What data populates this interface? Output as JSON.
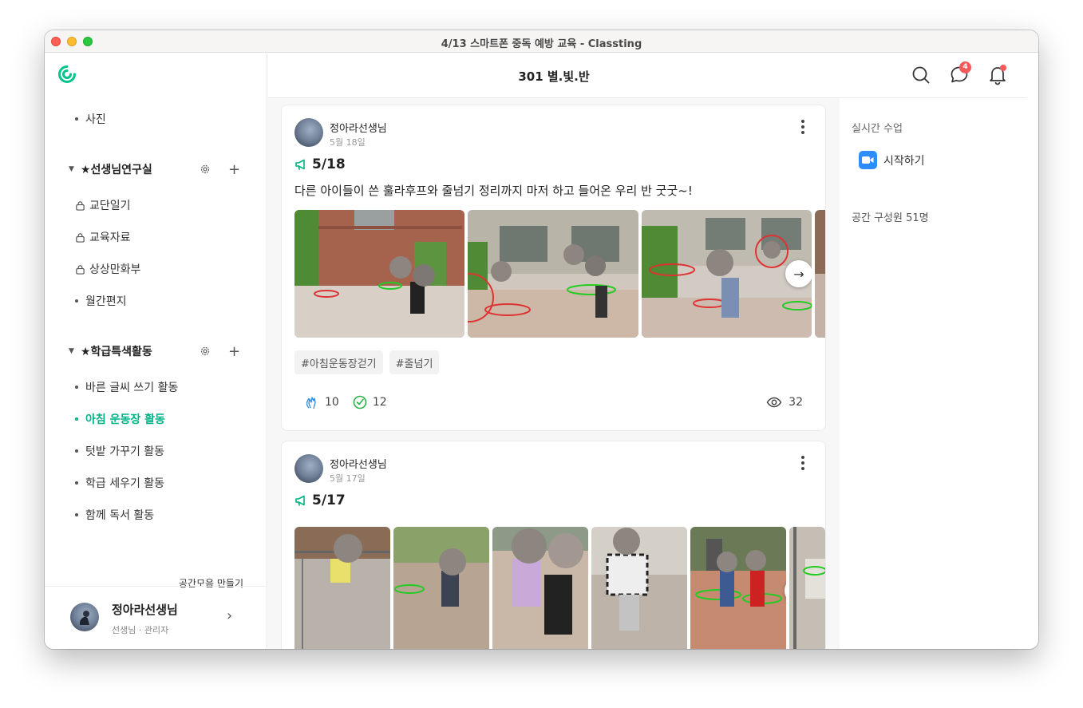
{
  "window": {
    "title": "4/13 스마트폰 중독 예방 교육 - Classting"
  },
  "sidebar": {
    "top_item": "사진",
    "sections": [
      {
        "title": "★선생님연구실",
        "items": [
          {
            "label": "교단일기",
            "locked": true
          },
          {
            "label": "교육자료",
            "locked": true
          },
          {
            "label": "상상만화부",
            "locked": true
          },
          {
            "label": "월간편지",
            "locked": false
          }
        ]
      },
      {
        "title": "★학급특색활동",
        "items": [
          {
            "label": "바른 글씨 쓰기 활동"
          },
          {
            "label": "아침 운동장 활동",
            "active": true
          },
          {
            "label": "텃밭 가꾸기 활동"
          },
          {
            "label": "학급 세우기 활동"
          },
          {
            "label": "함께 독서 활동"
          }
        ]
      }
    ],
    "make_collection": "공간모음 만들기",
    "profile": {
      "name": "정아라선생님",
      "role": "선생님 · 관리자"
    }
  },
  "header": {
    "class_name": "301 별.빛.반",
    "chat_badge": "4"
  },
  "posts": [
    {
      "author": "정아라선생님",
      "date": "5월 18일",
      "title": "5/18",
      "body": "다른 아이들이 쓴 훌라후프와 줄넘기 정리까지 마저 하고 들어온 우리 반 굿굿~!",
      "tags": [
        "#아침운동장걷기",
        "#줄넘기"
      ],
      "clap_count": "10",
      "check_count": "12",
      "view_count": "32"
    },
    {
      "author": "정아라선생님",
      "date": "5월 17일",
      "title": "5/17"
    }
  ],
  "right_panel": {
    "live_class_label": "실시간 수업",
    "start_label": "시작하기",
    "members_label": "공간 구성원 51명"
  },
  "colors": {
    "accent": "#00b386",
    "badge": "#f35b5b",
    "zoom": "#2d8cff"
  }
}
